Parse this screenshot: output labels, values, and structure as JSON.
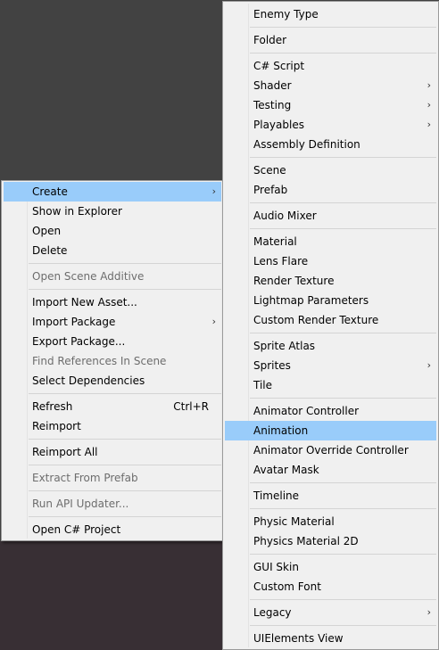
{
  "left_menu": {
    "items": [
      {
        "label": "Create",
        "highlighted": true,
        "submenu": true
      },
      {
        "label": "Show in Explorer"
      },
      {
        "label": "Open"
      },
      {
        "label": "Delete"
      },
      {
        "separator": true
      },
      {
        "label": "Open Scene Additive",
        "disabled": true
      },
      {
        "separator": true
      },
      {
        "label": "Import New Asset..."
      },
      {
        "label": "Import Package",
        "submenu": true
      },
      {
        "label": "Export Package..."
      },
      {
        "label": "Find References In Scene",
        "disabled": true
      },
      {
        "label": "Select Dependencies"
      },
      {
        "separator": true
      },
      {
        "label": "Refresh",
        "shortcut": "Ctrl+R"
      },
      {
        "label": "Reimport"
      },
      {
        "separator": true
      },
      {
        "label": "Reimport All"
      },
      {
        "separator": true
      },
      {
        "label": "Extract From Prefab",
        "disabled": true
      },
      {
        "separator": true
      },
      {
        "label": "Run API Updater...",
        "disabled": true
      },
      {
        "separator": true
      },
      {
        "label": "Open C# Project"
      }
    ]
  },
  "right_menu": {
    "items": [
      {
        "label": "Enemy Type"
      },
      {
        "separator": true
      },
      {
        "label": "Folder"
      },
      {
        "separator": true
      },
      {
        "label": "C# Script"
      },
      {
        "label": "Shader",
        "submenu": true
      },
      {
        "label": "Testing",
        "submenu": true
      },
      {
        "label": "Playables",
        "submenu": true
      },
      {
        "label": "Assembly Definition"
      },
      {
        "separator": true
      },
      {
        "label": "Scene"
      },
      {
        "label": "Prefab"
      },
      {
        "separator": true
      },
      {
        "label": "Audio Mixer"
      },
      {
        "separator": true
      },
      {
        "label": "Material"
      },
      {
        "label": "Lens Flare"
      },
      {
        "label": "Render Texture"
      },
      {
        "label": "Lightmap Parameters"
      },
      {
        "label": "Custom Render Texture"
      },
      {
        "separator": true
      },
      {
        "label": "Sprite Atlas"
      },
      {
        "label": "Sprites",
        "submenu": true
      },
      {
        "label": "Tile"
      },
      {
        "separator": true
      },
      {
        "label": "Animator Controller"
      },
      {
        "label": "Animation",
        "highlighted": true
      },
      {
        "label": "Animator Override Controller"
      },
      {
        "label": "Avatar Mask"
      },
      {
        "separator": true
      },
      {
        "label": "Timeline"
      },
      {
        "separator": true
      },
      {
        "label": "Physic Material"
      },
      {
        "label": "Physics Material 2D"
      },
      {
        "separator": true
      },
      {
        "label": "GUI Skin"
      },
      {
        "label": "Custom Font"
      },
      {
        "separator": true
      },
      {
        "label": "Legacy",
        "submenu": true
      },
      {
        "separator": true
      },
      {
        "label": "UIElements View"
      }
    ]
  },
  "icons": {
    "submenu_arrow": "chevron-right-icon"
  },
  "colors": {
    "highlight": "#99ccfa",
    "menu_background": "#f0f0f0",
    "disabled_text": "#6d6d6d"
  }
}
